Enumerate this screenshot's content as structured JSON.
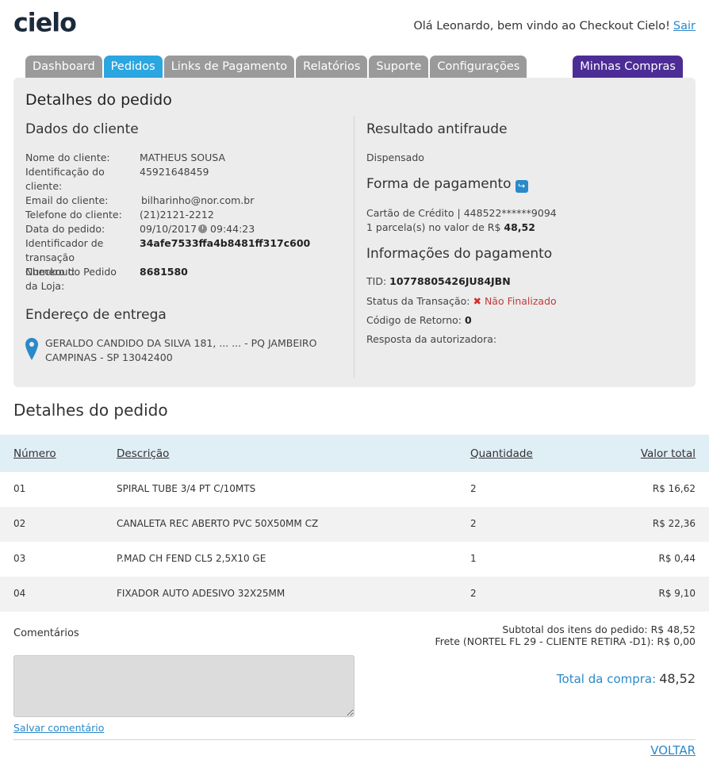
{
  "header": {
    "logo_text": "cielo",
    "greeting": "Olá Leonardo, bem vindo ao Checkout Cielo!",
    "logout_label": "Sair"
  },
  "tabs": [
    {
      "label": "Dashboard",
      "active": false
    },
    {
      "label": "Pedidos",
      "active": true
    },
    {
      "label": "Links de Pagamento",
      "active": false
    },
    {
      "label": "Relatórios",
      "active": false
    },
    {
      "label": "Suporte",
      "active": false
    },
    {
      "label": "Configurações",
      "active": false
    }
  ],
  "purchases_tab": "Minhas Compras",
  "panel": {
    "title": "Detalhes do pedido",
    "client": {
      "title": "Dados do cliente",
      "name_label": "Nome do cliente:",
      "name": "MATHEUS SOUSA",
      "id_label": "Identificação do cliente:",
      "id": "45921648459",
      "email_label": "Email do cliente:",
      "email": "bilharinho@nor.com.br",
      "phone_label": "Telefone do cliente:",
      "phone": "(21)2121-2212",
      "date_label": "Data do pedido:",
      "date": "09/10/2017",
      "time": "09:44:23",
      "tx_label": "Identificador de transação Checkout:",
      "tx": "34afe7533ffa4b8481ff317c600",
      "order_label": "Numero do Pedido da Loja:",
      "order": "8681580"
    },
    "address": {
      "title": "Endereço de entrega",
      "line1": "GERALDO CANDIDO DA SILVA 181, ... ... - PQ JAMBEIRO",
      "line2": "CAMPINAS - SP 13042400"
    },
    "antifraud": {
      "title": "Resultado antifraude",
      "value": "Dispensado"
    },
    "payment_method": {
      "title": "Forma de pagamento",
      "card": "Cartão de Crédito | 448522******9094",
      "installments_prefix": "1 parcela(s) no valor de R$",
      "installments_value": "48,52"
    },
    "payment_info": {
      "title": "Informações do pagamento",
      "tid_label": "TID:",
      "tid": "10778805426JU84JBN",
      "status_label": "Status da Transação:",
      "status": "Não Finalizado",
      "return_label": "Código de Retorno:",
      "return": "0",
      "auth_label": "Resposta da autorizadora:"
    }
  },
  "order_details": {
    "title": "Detalhes do pedido",
    "columns": [
      "Número",
      "Descrição",
      "Quantidade",
      "Valor total"
    ],
    "rows": [
      {
        "num": "01",
        "desc": "SPIRAL TUBE 3/4 PT C/10MTS",
        "qty": "2",
        "total": "R$ 16,62"
      },
      {
        "num": "02",
        "desc": "CANALETA REC ABERTO PVC 50X50MM CZ",
        "qty": "2",
        "total": "R$ 22,36"
      },
      {
        "num": "03",
        "desc": "P.MAD CH FEND CL5 2,5X10 GE",
        "qty": "1",
        "total": "R$ 0,44"
      },
      {
        "num": "04",
        "desc": "FIXADOR AUTO ADESIVO 32X25MM",
        "qty": "2",
        "total": "R$ 9,10"
      }
    ]
  },
  "footer": {
    "comments_label": "Comentários",
    "subtotal": "Subtotal dos itens do pedido: R$ 48,52",
    "shipping": "Frete (NORTEL FL 29 - CLIENTE RETIRA -D1): R$ 0,00",
    "total_label": "Total da compra:",
    "total_value": "48,52",
    "save_comment": "Salvar comentário",
    "back": "VOLTAR"
  },
  "colors": {
    "accent": "#2aa6e0",
    "purple": "#4c2d96",
    "link": "#2a89c8"
  }
}
